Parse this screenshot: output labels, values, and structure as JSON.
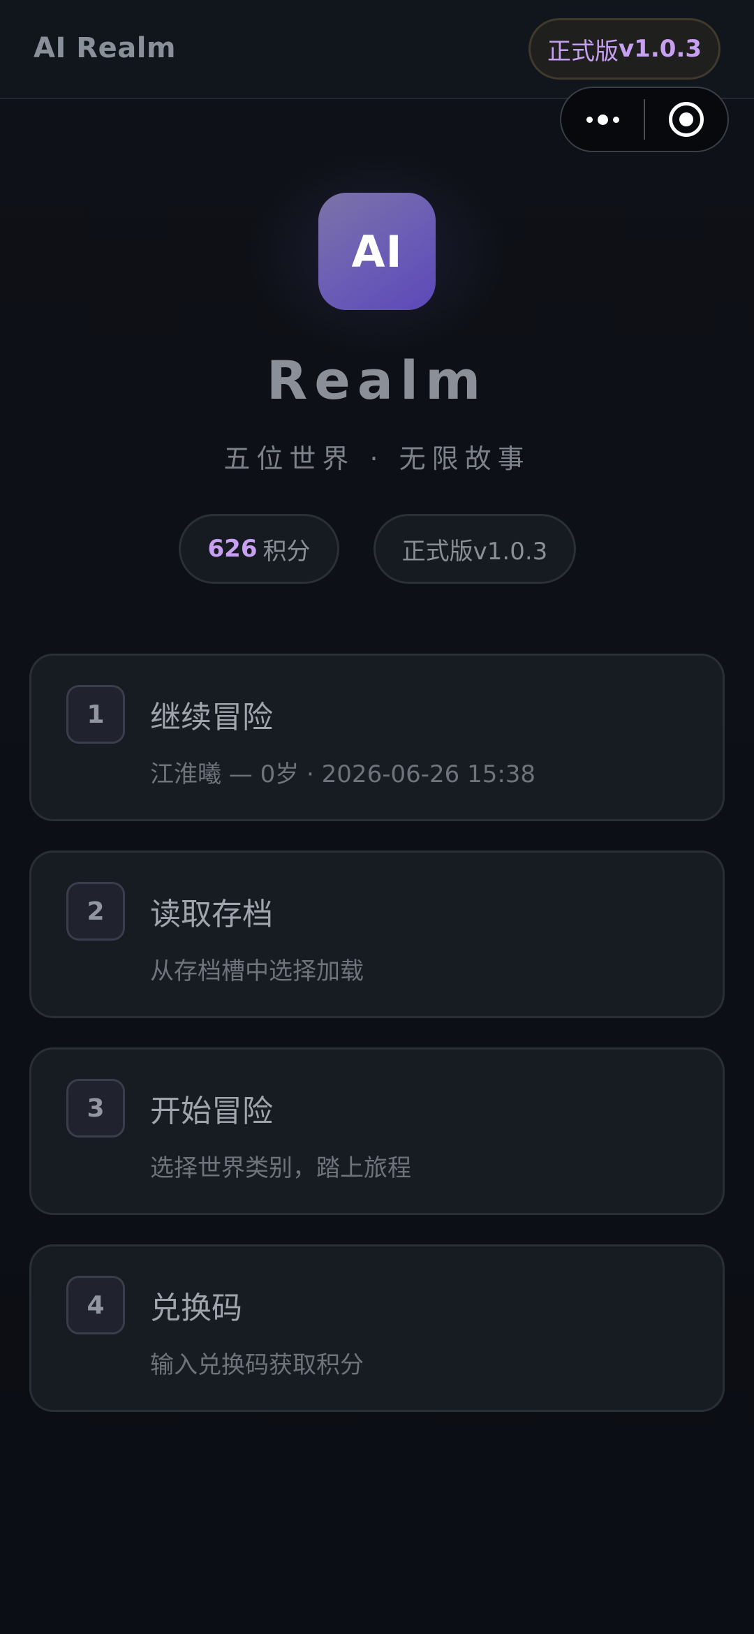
{
  "header": {
    "app_title": "AI Realm",
    "version_prefix": "正式版",
    "version_number": "v1.0.3"
  },
  "capsule": {
    "menu_icon": "more-dots-icon",
    "close_icon": "target-circle-icon"
  },
  "hero": {
    "logo_text": "AI",
    "brand": "Realm",
    "tagline": "五位世界 · 无限故事"
  },
  "stats": {
    "points_value": "626",
    "points_label": "积分",
    "version_label": "正式版v1.0.3"
  },
  "menu": [
    {
      "num": "1",
      "title": "继续冒险",
      "subtitle": "江淮曦 — 0岁 · 2026-06-26 15:38"
    },
    {
      "num": "2",
      "title": "读取存档",
      "subtitle": "从存档槽中选择加载"
    },
    {
      "num": "3",
      "title": "开始冒险",
      "subtitle": "选择世界类别，踏上旅程"
    },
    {
      "num": "4",
      "title": "兑换码",
      "subtitle": "输入兑换码获取积分"
    }
  ],
  "colors": {
    "background": "#0b0e14",
    "accent_purple": "#c7a0f2",
    "logo_gradient_start": "#7c73a8",
    "logo_gradient_end": "#5d48b8",
    "card_bg": "#171b22"
  }
}
